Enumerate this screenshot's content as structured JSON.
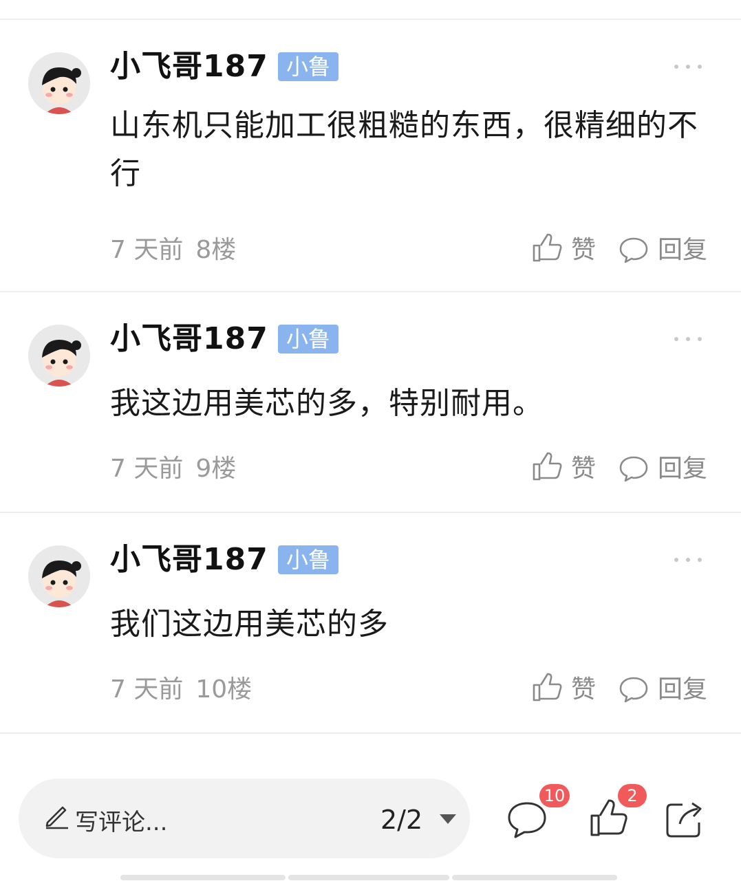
{
  "comments": [
    {
      "username": "小飞哥187",
      "badge": "小鲁",
      "content": "山东机只能加工很粗糙的东西，很精细的不行",
      "time": "7 天前",
      "floor": "8楼",
      "like_label": "赞",
      "reply_label": "回复"
    },
    {
      "username": "小飞哥187",
      "badge": "小鲁",
      "content": "我这边用美芯的多，特别耐用。",
      "time": "7 天前",
      "floor": "9楼",
      "like_label": "赞",
      "reply_label": "回复"
    },
    {
      "username": "小飞哥187",
      "badge": "小鲁",
      "content": "我们这边用美芯的多",
      "time": "7 天前",
      "floor": "10楼",
      "like_label": "赞",
      "reply_label": "回复"
    }
  ],
  "bottom_bar": {
    "comment_placeholder": "写评论...",
    "page_indicator": "2/2",
    "comment_count": "10",
    "like_count": "2"
  },
  "colors": {
    "badge": "#8ab4ee",
    "count_badge": "#f05a5a",
    "divider": "#ececec"
  },
  "icons": [
    "more-icon",
    "thumbs-up-icon",
    "speech-bubble-icon",
    "pencil-icon",
    "dropdown-arrow-icon",
    "share-icon"
  ]
}
